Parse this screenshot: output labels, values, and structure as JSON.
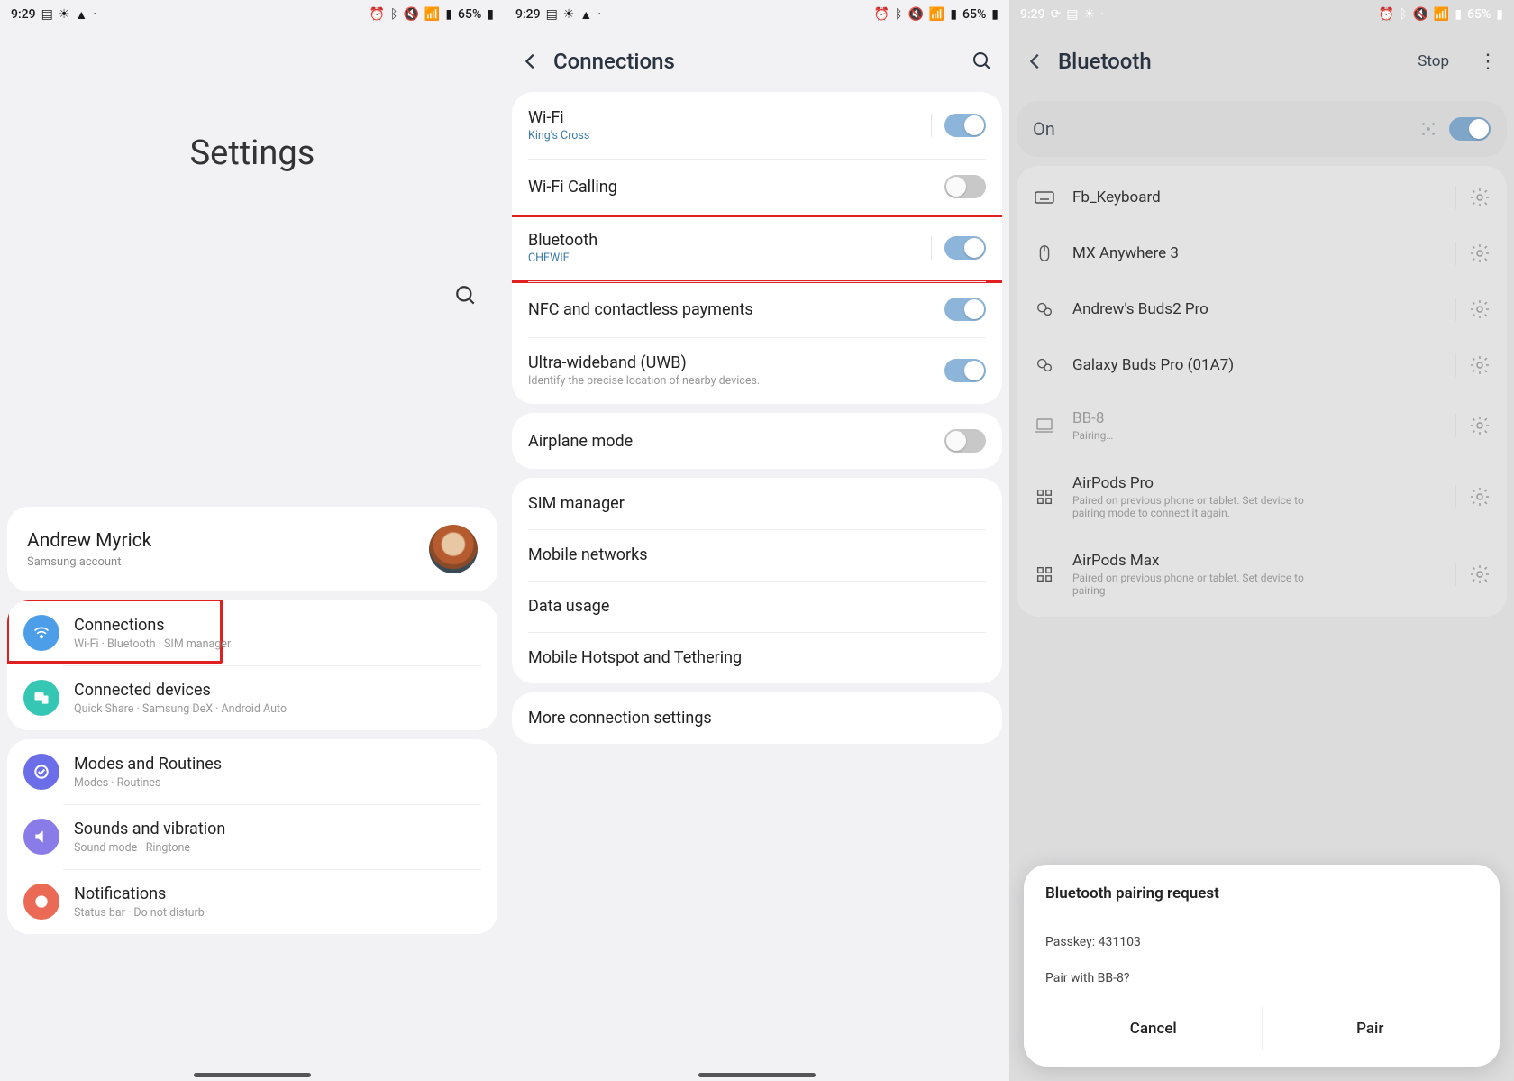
{
  "status": {
    "time": "9:29",
    "battery_pct": "65%"
  },
  "screen1": {
    "title": "Settings",
    "account": {
      "name": "Andrew Myrick",
      "sub": "Samsung account"
    },
    "items": [
      {
        "title": "Connections",
        "sub": "Wi-Fi · Bluetooth · SIM manager",
        "icon": "wifi",
        "color": "#4c9ee8"
      },
      {
        "title": "Connected devices",
        "sub": "Quick Share · Samsung DeX · Android Auto",
        "icon": "devices",
        "color": "#36c7b4"
      }
    ],
    "items2": [
      {
        "title": "Modes and Routines",
        "sub": "Modes · Routines",
        "icon": "modes",
        "color": "#6b6ee8"
      },
      {
        "title": "Sounds and vibration",
        "sub": "Sound mode · Ringtone",
        "icon": "sound",
        "color": "#8a7ce8"
      },
      {
        "title": "Notifications",
        "sub": "Status bar · Do not disturb",
        "icon": "notif",
        "color": "#ea6a55"
      }
    ]
  },
  "screen2": {
    "title": "Connections",
    "rows1": [
      {
        "title": "Wi-Fi",
        "sub": "King's Cross",
        "toggle": "on",
        "subAccent": true
      },
      {
        "title": "Wi-Fi Calling",
        "toggle": "off"
      },
      {
        "title": "Bluetooth",
        "sub": "CHEWIE",
        "toggle": "on",
        "subAccent": true
      },
      {
        "title": "NFC and contactless payments",
        "toggle": "on"
      },
      {
        "title": "Ultra-wideband (UWB)",
        "sub": "Identify the precise location of nearby devices.",
        "toggle": "on",
        "subAccent": false
      }
    ],
    "rows2": [
      {
        "title": "Airplane mode",
        "toggle": "off"
      }
    ],
    "rows3": [
      {
        "title": "SIM manager"
      },
      {
        "title": "Mobile networks"
      },
      {
        "title": "Data usage"
      },
      {
        "title": "Mobile Hotspot and Tethering"
      }
    ],
    "rows4": [
      {
        "title": "More connection settings"
      }
    ]
  },
  "screen3": {
    "title": "Bluetooth",
    "stop": "Stop",
    "on_label": "On",
    "devices": [
      {
        "name": "Fb_Keyboard",
        "icon": "keyboard"
      },
      {
        "name": "MX Anywhere 3",
        "icon": "mouse"
      },
      {
        "name": "Andrew's Buds2 Pro",
        "icon": "buds"
      },
      {
        "name": "Galaxy Buds Pro (01A7)",
        "icon": "buds"
      },
      {
        "name": "BB-8",
        "sub": "Pairing…",
        "icon": "laptop",
        "muted": true
      },
      {
        "name": "AirPods Pro",
        "sub": "Paired on previous phone or tablet. Set device to pairing mode to connect it again.",
        "icon": "grid"
      },
      {
        "name": "AirPods Max",
        "sub": "Paired on previous phone or tablet. Set device to pairing",
        "icon": "grid"
      }
    ],
    "dialog": {
      "title": "Bluetooth pairing request",
      "passkey_label": "Passkey: 431103",
      "question": "Pair with BB-8?",
      "cancel": "Cancel",
      "pair": "Pair"
    }
  }
}
